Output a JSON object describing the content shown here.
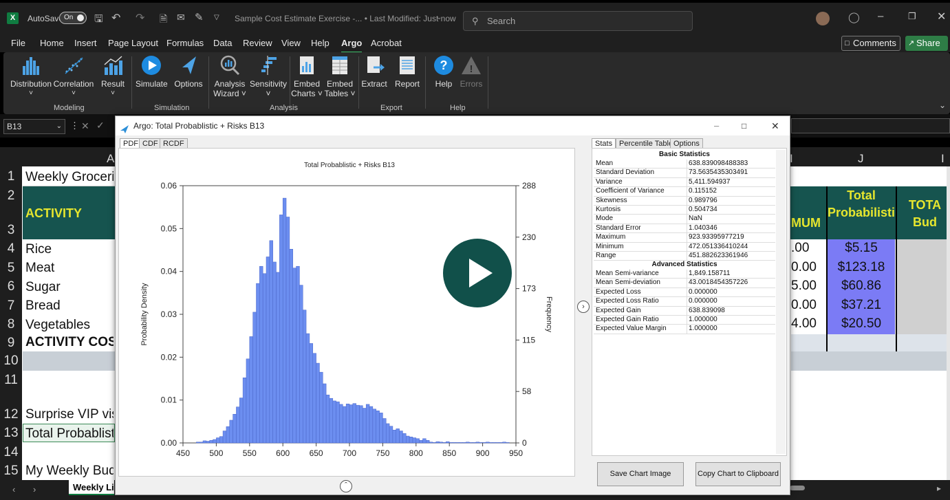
{
  "titlebar": {
    "app_icon": "X",
    "autosave_label": "AutoSave",
    "autosave_state": "On",
    "doc_title": "Sample Cost Estimate Exercise -...  • Last Modified: Just now",
    "search_placeholder": "Search"
  },
  "menu": [
    "File",
    "Home",
    "Insert",
    "Page Layout",
    "Formulas",
    "Data",
    "Review",
    "View",
    "Help",
    "Argo",
    "Acrobat"
  ],
  "menu_active": "Argo",
  "comments_label": "Comments",
  "share_label": "Share",
  "ribbon": {
    "modeling_buttons": [
      "Distribution",
      "Correlation",
      "Result"
    ],
    "simulation_buttons": [
      "Simulate",
      "Options"
    ],
    "analysis_buttons": [
      {
        "l1": "Analysis",
        "l2": "Wizard ˅"
      },
      {
        "l1": "Sensitivity",
        "l2": "˅"
      },
      {
        "l1": "Embed",
        "l2": "Charts ˅"
      },
      {
        "l1": "Embed",
        "l2": "Tables ˅"
      }
    ],
    "export_buttons": [
      "Extract",
      "Report"
    ],
    "help_buttons": [
      "Help",
      "Errors"
    ],
    "groups": [
      "Modeling",
      "Simulation",
      "Analysis",
      "Export",
      "Help"
    ]
  },
  "namebox": "B13",
  "sheet": {
    "col_a_header": "A",
    "col_i_header": "I",
    "col_j_header": "J",
    "rows": [
      {
        "n": "1",
        "a": "Weekly Groceries"
      },
      {
        "n": "2",
        "a": ""
      },
      {
        "n": "3",
        "a": ""
      },
      {
        "n": "4",
        "a": "Rice"
      },
      {
        "n": "5",
        "a": "Meat"
      },
      {
        "n": "6",
        "a": "Sugar"
      },
      {
        "n": "7",
        "a": "Bread"
      },
      {
        "n": "8",
        "a": "Vegetables"
      },
      {
        "n": "9",
        "a": "ACTIVITY COST"
      },
      {
        "n": "10",
        "a": ""
      },
      {
        "n": "11",
        "a": ""
      },
      {
        "n": "12",
        "a": "Surprise VIP visit"
      },
      {
        "n": "13",
        "a": "Total Probablistic"
      },
      {
        "n": "14",
        "a": ""
      },
      {
        "n": "15",
        "a": "My Weekly Budget"
      }
    ],
    "activity_header": "ACTIVITY",
    "i_header": "MUM",
    "i_values": [
      ".00",
      "0.00",
      "5.00",
      "0.00",
      "4.00"
    ],
    "j_header": "Total Probabilistic",
    "j_values": [
      "$5.15",
      "$123.18",
      "$60.86",
      "$37.21",
      "$20.50"
    ],
    "k_header": "TOTA Bud",
    "sheet_tab": "Weekly Liv"
  },
  "dialog": {
    "title": "Argo: Total Probablistic + Risks B13",
    "tabs": [
      "PDF",
      "CDF",
      "RCDF"
    ],
    "right_tabs": [
      "Stats",
      "Percentile Table",
      "Options"
    ],
    "basic_header": "Basic Statistics",
    "advanced_header": "Advanced Statistics",
    "basic_stats": [
      [
        "Mean",
        "638.839098488383"
      ],
      [
        "Standard Deviation",
        "73.5635435303491"
      ],
      [
        "Variance",
        "5,411.594937"
      ],
      [
        "Coefficient of Variance",
        "0.115152"
      ],
      [
        "Skewness",
        "0.989796"
      ],
      [
        "Kurtosis",
        "0.504734"
      ],
      [
        "Mode",
        "NaN"
      ],
      [
        "Standard Error",
        "1.040346"
      ],
      [
        "Maximum",
        "923.93395977219"
      ],
      [
        "Minimum",
        "472.051336410244"
      ],
      [
        "Range",
        "451.882623361946"
      ]
    ],
    "advanced_stats": [
      [
        "Mean Semi-variance",
        "1,849.158711"
      ],
      [
        "Mean Semi-deviation",
        "43.0018454357226"
      ],
      [
        "Expected Loss",
        "0.000000"
      ],
      [
        "Expected Loss Ratio",
        "0.000000"
      ],
      [
        "Expected Gain",
        "638.839098"
      ],
      [
        "Expected Gain Ratio",
        "1.000000"
      ],
      [
        "Expected Value Margin",
        "1.000000"
      ]
    ],
    "save_button": "Save Chart Image",
    "copy_button": "Copy Chart to Clipboard"
  },
  "chart_data": {
    "type": "bar",
    "title": "Total Probablistic + Risks B13",
    "xlabel": "",
    "ylabel": "Probability Density",
    "y2label": "Frequency",
    "xlim": [
      450,
      950
    ],
    "ylim": [
      0,
      0.06
    ],
    "xticks": [
      450,
      500,
      550,
      600,
      650,
      700,
      750,
      800,
      850,
      900,
      950
    ],
    "yticks": [
      0.0,
      0.01,
      0.02,
      0.03,
      0.04,
      0.05,
      0.06
    ],
    "y2ticks": [
      "0",
      "58",
      "115",
      "173",
      "230",
      "288"
    ],
    "bin_width": 5,
    "bins_start": 470,
    "values": [
      0.0002,
      0.0002,
      0.0005,
      0.0004,
      0.0006,
      0.0008,
      0.0012,
      0.0015,
      0.0028,
      0.0038,
      0.0053,
      0.0067,
      0.0084,
      0.0105,
      0.0152,
      0.0196,
      0.0248,
      0.0305,
      0.0372,
      0.0412,
      0.0395,
      0.0434,
      0.0472,
      0.0422,
      0.0398,
      0.0532,
      0.0571,
      0.0527,
      0.0452,
      0.0408,
      0.0412,
      0.0368,
      0.031,
      0.0255,
      0.0232,
      0.0209,
      0.0186,
      0.0165,
      0.0138,
      0.0112,
      0.0104,
      0.0098,
      0.0096,
      0.009,
      0.0085,
      0.0091,
      0.0089,
      0.0092,
      0.0088,
      0.0087,
      0.0081,
      0.009,
      0.0085,
      0.0079,
      0.0075,
      0.007,
      0.0057,
      0.0045,
      0.0039,
      0.003,
      0.0033,
      0.0028,
      0.0022,
      0.0016,
      0.0014,
      0.0012,
      0.001,
      0.0006,
      0.001,
      0.0006,
      0.0002,
      0.0001,
      0.0003,
      0.0002,
      0.0001,
      0.0003,
      0.0001,
      0.0001,
      0.0001,
      0.0001,
      0.0001,
      0.0002,
      0.0001,
      0.0001,
      0.0002,
      0.0001,
      0.0001,
      0.0002,
      0.0001,
      0.0001,
      0.0001,
      0.0001,
      0.0002,
      0.0001
    ]
  }
}
